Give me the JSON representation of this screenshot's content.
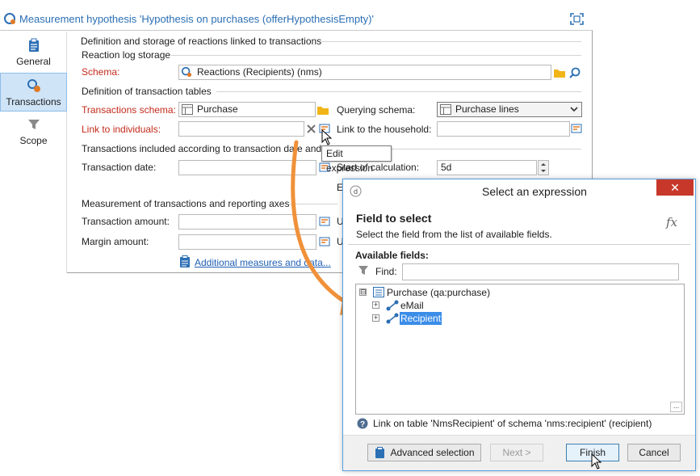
{
  "window": {
    "title": "Measurement hypothesis 'Hypothesis on purchases (offerHypothesisEmpty)'"
  },
  "sidebar": {
    "items": [
      {
        "label": "General",
        "icon": "clipboard-icon"
      },
      {
        "label": "Transactions",
        "icon": "gear-link-icon",
        "active": true
      },
      {
        "label": "Scope",
        "icon": "funnel-icon"
      }
    ]
  },
  "form": {
    "section_title": "Definition and storage of reactions linked to transactions",
    "reaction_log_storage": "Reaction log storage",
    "schema_label": "Schema:",
    "schema_value": "Reactions (Recipients) (nms)",
    "transaction_tables": "Definition of transaction tables",
    "transactions_schema_label": "Transactions schema:",
    "transactions_schema_value": "Purchase",
    "querying_schema_label": "Querying schema:",
    "querying_schema_value": "Purchase lines",
    "link_individuals_label": "Link to individuals:",
    "link_household_label": "Link to the household:",
    "transactions_included": "Transactions included according to transaction date and",
    "transaction_date_label": "Transaction date:",
    "start_calc_label": "Start of calculation:",
    "start_calc_value": "5d",
    "e_label": "E",
    "measurement_title": "Measurement of transactions and reporting axes",
    "transaction_amount_label": "Transaction amount:",
    "margin_amount_label": "Margin amount:",
    "u_label": "U",
    "additional_link": "Additional measures and data..."
  },
  "tooltip": {
    "text": "Edit expression"
  },
  "dialog": {
    "title": "Select an expression",
    "close_glyph": "✕",
    "heading": "Field to select",
    "subheading": "Select the field from the list of available fields.",
    "fx": "fx",
    "available_fields": "Available fields:",
    "find_label": "Find:",
    "find_value": "",
    "tree": [
      {
        "label": "Purchase (qa:purchase)",
        "expander": "⊟"
      },
      {
        "label": "eMail",
        "expander": "+"
      },
      {
        "label": "Recipient",
        "expander": "+",
        "selected": true
      }
    ],
    "ellipsis": "...",
    "info_text": "Link on table 'NmsRecipient' of schema 'nms:recipient' (recipient)",
    "buttons": {
      "advanced": "Advanced selection",
      "next": "Next >",
      "finish": "Finish",
      "cancel": "Cancel"
    }
  },
  "colors": {
    "accent": "#2c6fb5",
    "required": "#c42b1c",
    "selection": "#3b8de8",
    "arrow": "#f0913a",
    "close": "#c7382b"
  }
}
